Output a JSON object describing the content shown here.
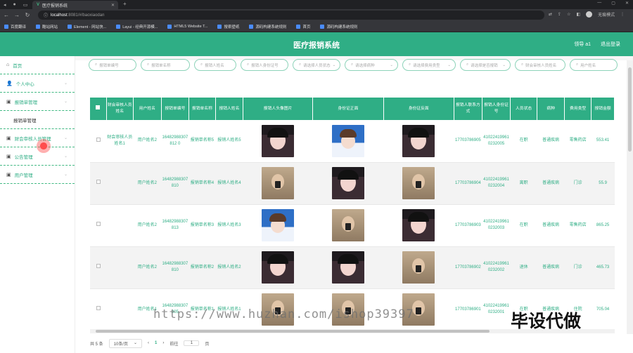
{
  "browser": {
    "tab_title": "医疗报销系统",
    "url_host": "localhost",
    "url_path": ":8081/#/baoxiaodan",
    "profile_label": "无痕模式",
    "bookmarks": [
      "百度翻译",
      "酷站网站",
      "Element - 网站快...",
      "Layui - 经典开源模...",
      "HTML5 Website T...",
      "搜索壁纸",
      "源码构建系统规则",
      "首页",
      "源码构建系统规则"
    ]
  },
  "app": {
    "title": "医疗报销系统",
    "user": "领导 a1",
    "logout": "退出登录"
  },
  "sidebar": {
    "items": [
      {
        "label": "首页",
        "icon": "home-icon"
      },
      {
        "label": "个人中心",
        "icon": "user-icon"
      },
      {
        "label": "报销单管理",
        "icon": "chat-icon"
      },
      {
        "label": "报销单管理",
        "sub": true
      },
      {
        "label": "财会审核人员管理",
        "icon": "chat-icon"
      },
      {
        "label": "公告管理",
        "icon": "chat-icon"
      },
      {
        "label": "用户管理",
        "icon": "chat-icon"
      }
    ]
  },
  "search": {
    "fields": [
      {
        "placeholder": "报销单编号"
      },
      {
        "placeholder": "报销单名称"
      },
      {
        "placeholder": "报销人姓名"
      },
      {
        "placeholder": "报销人身份证号"
      },
      {
        "placeholder": "请选择人员状态"
      },
      {
        "placeholder": "请选择病种"
      },
      {
        "placeholder": "请选择费用类型"
      },
      {
        "placeholder": "请选择是否报销"
      },
      {
        "placeholder": "财会审核人员姓名"
      },
      {
        "placeholder": "用户姓名"
      }
    ]
  },
  "table": {
    "headers": [
      "财会审核人员姓名",
      "用户姓名",
      "报销单编号",
      "报销单名称",
      "报销人姓名",
      "报销人头像图片",
      "身份证正面",
      "身份证反面",
      "报销人联系方式",
      "报销人身份证号",
      "人员状态",
      "病种",
      "费用类型",
      "报销金额"
    ],
    "rows": [
      {
        "auditor": "财会审核人员姓名1",
        "user": "用户姓名2",
        "code": "16482988307812 0",
        "name": "报销单名称5",
        "person": "报销人姓名5",
        "photos": [
          "girl",
          "boy",
          "girl"
        ],
        "phone": "17703786905",
        "idno": "410224199610232005",
        "status": "在职",
        "disease": "普通疾病",
        "fee": "零售药店",
        "amount": "553.41"
      },
      {
        "auditor": "",
        "user": "用户姓名2",
        "code": "16482988307810",
        "name": "报销单名称4",
        "person": "报销人姓名4",
        "photos": [
          "tan",
          "girl",
          "tan"
        ],
        "phone": "17703786904",
        "idno": "410224199610232004",
        "status": "离职",
        "disease": "普通疾病",
        "fee": "门诊",
        "amount": "55.9"
      },
      {
        "auditor": "",
        "user": "用户姓名2",
        "code": "16482988307813",
        "name": "报销单名称3",
        "person": "报销人姓名3",
        "photos": [
          "boy",
          "tan",
          "girl"
        ],
        "phone": "17703786903",
        "idno": "410224199610232003",
        "status": "在职",
        "disease": "普通疾病",
        "fee": "零售药店",
        "amount": "865.25"
      },
      {
        "auditor": "",
        "user": "用户姓名2",
        "code": "16482988307810",
        "name": "报销单名称2",
        "person": "报销人姓名2",
        "photos": [
          "girl",
          "girl",
          "tan"
        ],
        "phone": "17703786902",
        "idno": "410224199610232002",
        "status": "退休",
        "disease": "普通疾病",
        "fee": "门诊",
        "amount": "465.73"
      },
      {
        "auditor": "",
        "user": "用户姓名1",
        "code": "16482988307805",
        "name": "报销单名称1",
        "person": "报销人姓名1",
        "photos": [
          "tan",
          "tan",
          "tan"
        ],
        "phone": "17703786901",
        "idno": "410224199610232001",
        "status": "在职",
        "disease": "普通疾病",
        "fee": "住院",
        "amount": "705.04"
      }
    ]
  },
  "pager": {
    "total": "共 5 条",
    "size": "10条/页",
    "prev": "‹",
    "page": "1",
    "next": "›",
    "goto": "前往",
    "goto_value": "1",
    "page_unit": "页"
  },
  "watermark": {
    "url": "https://www.huzhan.com/ishop39397",
    "text": "毕设代做"
  },
  "colors": {
    "accent": "#2fae85",
    "chrome": "#35363a"
  }
}
